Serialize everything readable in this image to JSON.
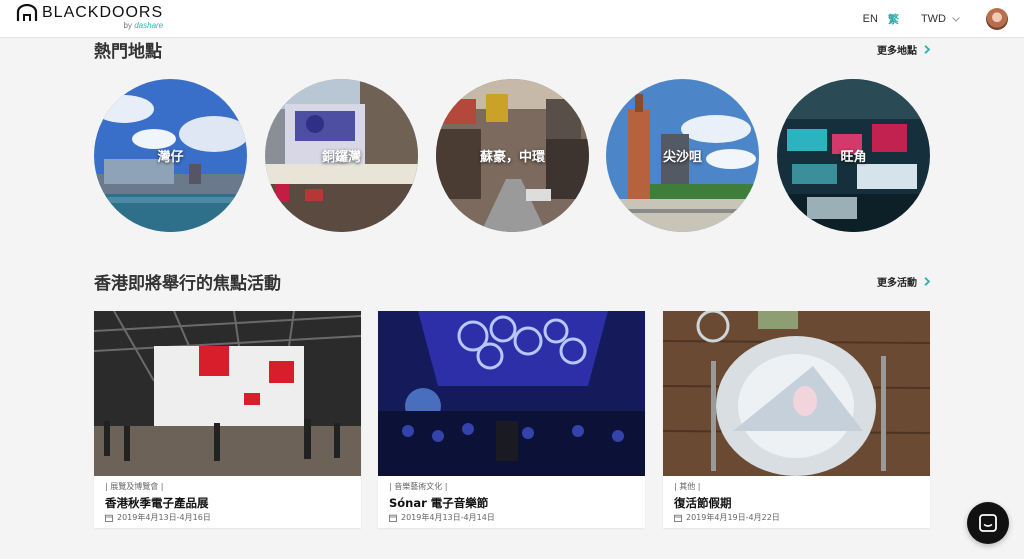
{
  "header": {
    "brand": "BLACKDOORS",
    "brand_sub_by": "by",
    "brand_sub_name": "dashare",
    "lang_en": "EN",
    "lang_zh": "繁",
    "currency": "TWD"
  },
  "places_section": {
    "title": "熱門地點",
    "more": "更多地點",
    "items": [
      {
        "label": "灣仔"
      },
      {
        "label": "銅鑼灣"
      },
      {
        "label": "蘇豪，中環"
      },
      {
        "label": "尖沙咀"
      },
      {
        "label": "旺角"
      }
    ]
  },
  "events_section": {
    "title": "香港即將舉行的焦點活動",
    "more": "更多活動",
    "items": [
      {
        "category": "| 展覽及博覽會 |",
        "title": "香港秋季電子產品展",
        "date": "2019年4月13日-4月16日"
      },
      {
        "category": "| 音樂藝術文化 |",
        "title": "Sónar 電子音樂節",
        "date": "2019年4月13日-4月14日"
      },
      {
        "category": "| 其他 |",
        "title": "復活節假期",
        "date": "2019年4月19日-4月22日"
      }
    ]
  },
  "colors": {
    "accent": "#2bb0ad",
    "background": "#f4f4f4",
    "chat_button": "#111111"
  }
}
